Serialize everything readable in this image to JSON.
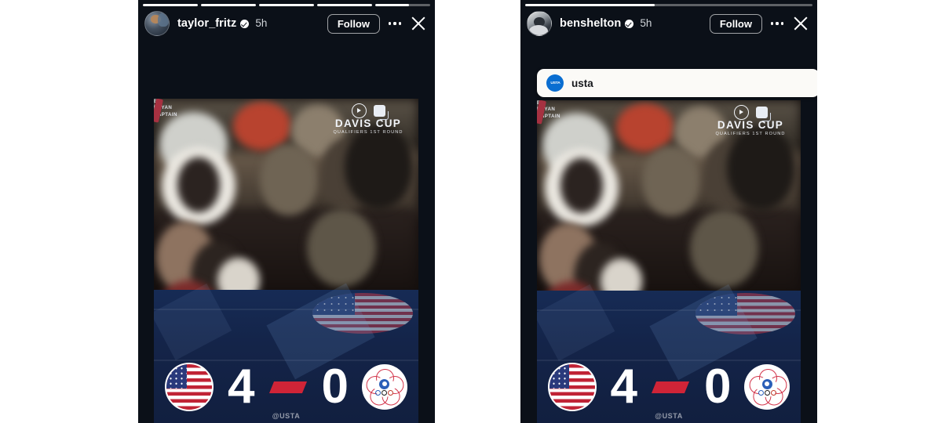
{
  "page": {
    "background": "#ffffff",
    "panel_background": "#0b1018"
  },
  "stories": [
    {
      "id": "left-story",
      "progress": {
        "segments": 5,
        "active_index": 4,
        "active_fill_percent": 62
      },
      "header": {
        "avatar_name": "taylor-fritz-avatar",
        "username": "taylor_fritz",
        "verified": true,
        "age": "5h",
        "follow_label": "Follow",
        "more_icon": "more-options-icon",
        "close_icon": "close-icon"
      },
      "mention_sticker": null,
      "media": {
        "brand": {
          "name": "DAVIS CUP",
          "sub": "QUALIFIERS 1ST ROUND"
        },
        "jacket_text": "B BRYAN\nCAPTAIN",
        "score": {
          "home_team": "USA",
          "home_value": "4",
          "separator": "-",
          "away_team": "Chinese Taipei",
          "away_value": "0"
        },
        "watermark": "@USTA"
      }
    },
    {
      "id": "right-story",
      "progress": {
        "segments": 1,
        "active_index": 0,
        "active_fill_percent": 45
      },
      "header": {
        "avatar_name": "ben-shelton-avatar",
        "username": "benshelton",
        "verified": true,
        "age": "5h",
        "follow_label": "Follow",
        "more_icon": "more-options-icon",
        "close_icon": "close-icon"
      },
      "mention_sticker": {
        "logo_text": "USTA",
        "handle": "usta"
      },
      "media": {
        "brand": {
          "name": "DAVIS CUP",
          "sub": "QUALIFIERS 1ST ROUND"
        },
        "jacket_text": "B BRYAN\nCAPTAIN",
        "score": {
          "home_team": "USA",
          "home_value": "4",
          "separator": "-",
          "away_team": "Chinese Taipei",
          "away_value": "0"
        },
        "watermark": "@USTA"
      }
    }
  ],
  "colors": {
    "accent_red": "#cf2437",
    "navy": "#162b55",
    "white": "#ffffff",
    "usta_blue": "#0a6ed1"
  }
}
